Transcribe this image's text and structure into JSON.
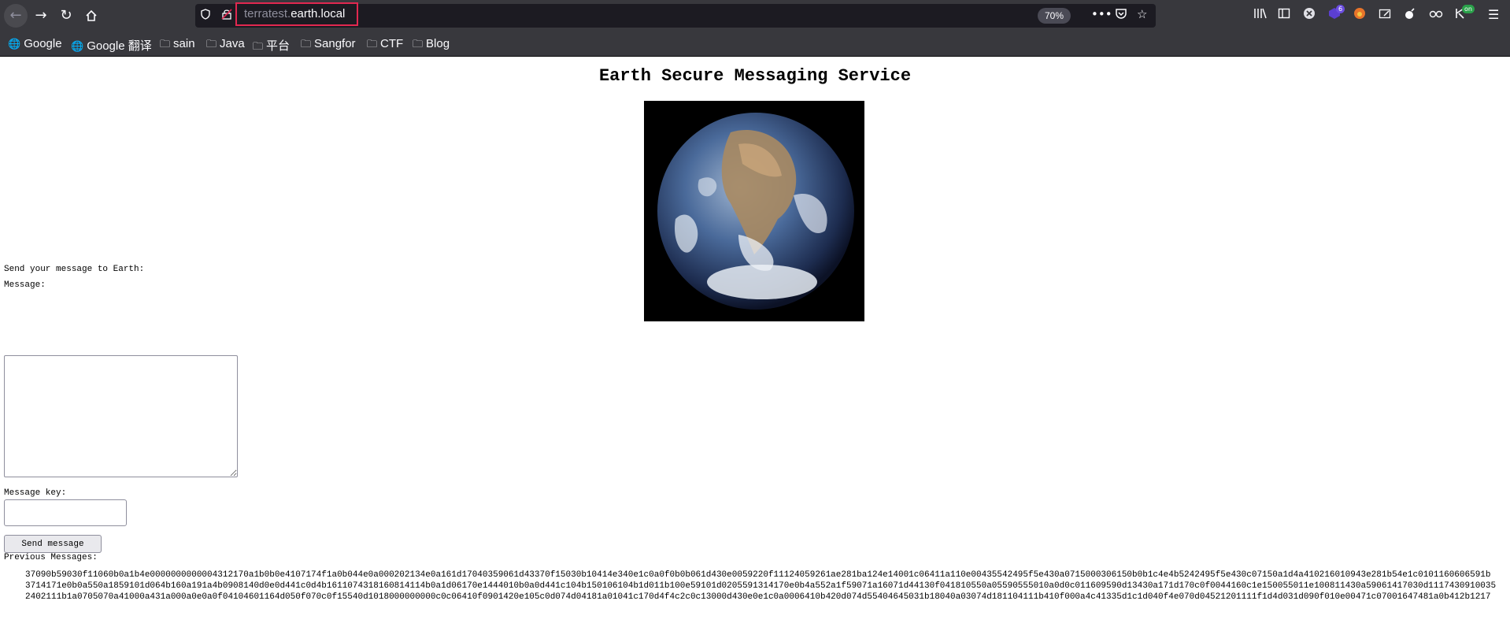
{
  "browser": {
    "url_subdomain": "terratest.",
    "url_domain": "earth.local",
    "zoom": "70%",
    "library_badge": "6",
    "ext_badge": "on",
    "bookmarks": [
      {
        "label": "Google",
        "icon": "globe-icon"
      },
      {
        "label": "Google 翻译",
        "icon": "globe-icon"
      },
      {
        "label": "sain",
        "icon": "folder-icon"
      },
      {
        "label": "Java",
        "icon": "folder-icon"
      },
      {
        "label": "平台",
        "icon": "folder-icon"
      },
      {
        "label": "Sangfor",
        "icon": "folder-icon"
      },
      {
        "label": "CTF",
        "icon": "folder-icon"
      },
      {
        "label": "Blog",
        "icon": "folder-icon"
      }
    ]
  },
  "page": {
    "title": "Earth Secure Messaging Service",
    "send_prompt": "Send your message to Earth:",
    "message_label": "Message:",
    "message_value": "",
    "key_label": "Message key:",
    "key_value": "",
    "send_button": "Send message",
    "previous_label": "Previous Messages:",
    "messages": [
      "37090b59030f11060b0a1b4e0000000000004312170a1b0b0e4107174f1a0b044e0a000202134e0a161d17040359061d43370f15030b10414e340e1c0a0f0b0b061d430e0059220f11124059261ae281ba124e14001c06411a110e00435542495f5e430a0715000306150b0b1c4e4b5242495f5e430c07150a1d4a410216010943e281b54e1c0101160606591b",
      "3714171e0b0a550a1859101d064b160a191a4b0908140d0e0d441c0d4b1611074318160814114b0a1d06170e1444010b0a0d441c104b150106104b1d011b100e59101d0205591314170e0b4a552a1f59071a16071d44130f041810550a05590555010a0d0c011609590d13430a171d170c0f0044160c1e150055011e100811430a59061417030d1117430910035",
      "2402111b1a0705070a41000a431a000a0e0a0f04104601164d050f070c0f15540d1018000000000c0c06410f0901420e105c0d074d04181a01041c170d4f4c2c0c13000d430e0e1c0a0006410b420d074d55404645031b18040a03074d181104111b410f000a4c41335d1c1d040f4e070d04521201111f1d4d031d090f010e00471c07001647481a0b412b1217"
    ]
  },
  "colors": {
    "chrome_bg": "#38383d",
    "urlbar_bg": "#1c1b22",
    "highlight": "#e22850"
  }
}
